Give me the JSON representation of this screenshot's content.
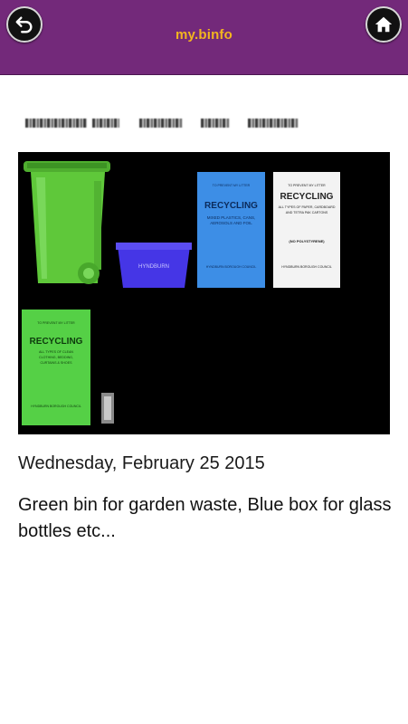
{
  "app": {
    "title": "my.binfo"
  },
  "post": {
    "date": "Wednesday, February 25 2015",
    "description": "Green bin for garden waste, Blue box for glass bottles etc..."
  },
  "image": {
    "box_label": "HYNDBURN",
    "blue_sack": {
      "warning": "TO PREVENT MY LITTER FROM BEING TAKEN BACK FOR COLLECTION AND DO NOT OVERFILL",
      "heading": "RECYCLING",
      "sub": "MIXED PLASTICS, CANS, AEROSOLS AND FOIL",
      "body": "PLEASE PLACE THIS SACK ON THE KERBSIDE AT THE FRONT OF YOUR PROPERTY BY 7.00AM ON YOUR COLLECTION DAY",
      "council": "HYNDBURN BOROUGH COUNCIL"
    },
    "white_sack": {
      "warning": "TO PREVENT MY LITTER FROM BEING TAKEN BACK FOR COLLECTION",
      "heading": "RECYCLING",
      "sub": "ALL TYPES OF PAPER, CARDBOARD AND TETRA PAK CARTONS",
      "note": "(NO POLYSTYRENE)",
      "council": "HYNDBURN BOROUGH COUNCIL"
    },
    "green_sack": {
      "warning": "TO PREVENT MY LITTER FROM BEING TAKEN BACK FOR COLLECTION AND DO NOT OVERFILL",
      "heading": "RECYCLING",
      "sub": "ALL TYPES OF CLEAN CLOTHING, BEDDING, CURTAINS & SHOES",
      "council": "HYNDBURN BOROUGH COUNCIL"
    }
  },
  "colors": {
    "appbar": "#73297a",
    "title": "#f2b51f",
    "green_bin": "#5fc83a",
    "blue_box": "#4536e6",
    "blue_sack": "#3d8ee6",
    "green_sack": "#55d046"
  },
  "icons": {
    "back": "back-arrow-icon",
    "home": "home-icon"
  }
}
